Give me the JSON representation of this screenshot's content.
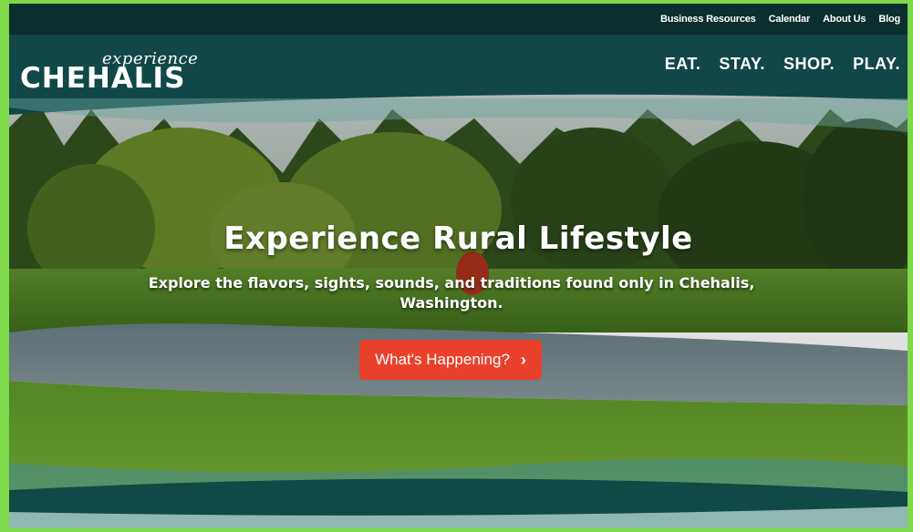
{
  "topnav": {
    "items": [
      "Business Resources",
      "Calendar",
      "About Us",
      "Blog"
    ]
  },
  "logo": {
    "script": "experience",
    "main": "CHEHALIS"
  },
  "mainnav": {
    "items": [
      "EAT.",
      "STAY.",
      "SHOP.",
      "PLAY."
    ]
  },
  "hero": {
    "title": "Experience Rural Lifestyle",
    "subtitle": "Explore the flavors, sights, sounds, and traditions found only in Chehalis, Washington.",
    "cta_label": "What's Happening?",
    "cta_icon": "chevron-right-icon"
  },
  "colors": {
    "page_border": "#7ed94a",
    "topbar": "#0b2e2e",
    "header": "#114747",
    "cta": "#e8412c"
  }
}
